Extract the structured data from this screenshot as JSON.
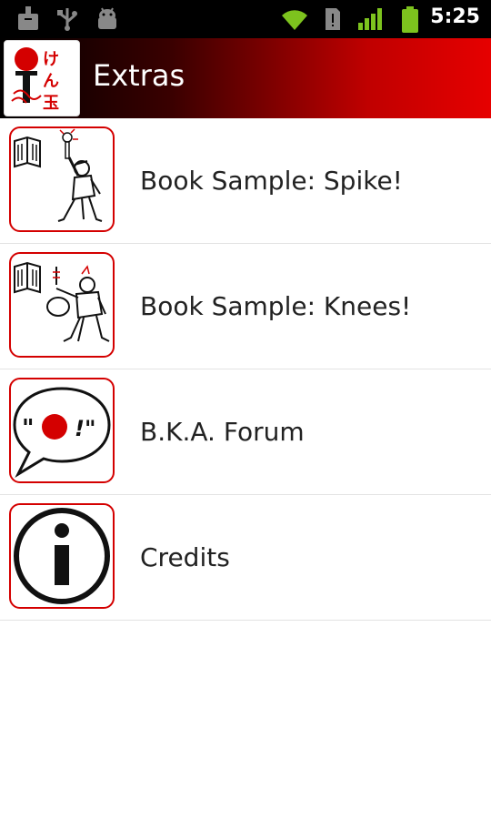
{
  "status_bar": {
    "time": "5:25",
    "icons": [
      "download-icon",
      "usb-icon",
      "android-debug-icon",
      "wifi-icon",
      "sim-icon",
      "signal-icon",
      "battery-icon"
    ]
  },
  "title_bar": {
    "title": "Extras",
    "logo_text": "けん玉"
  },
  "list": {
    "items": [
      {
        "label": "Book Sample: Spike!",
        "icon": "book-spike-icon"
      },
      {
        "label": "Book Sample: Knees!",
        "icon": "book-knees-icon"
      },
      {
        "label": "B.K.A. Forum",
        "icon": "forum-speech-bubble-icon",
        "icon_text": "\"  !\""
      },
      {
        "label": "Credits",
        "icon": "info-icon"
      }
    ]
  },
  "colors": {
    "accent": "#d40000",
    "title_gradient_start": "#000000",
    "title_gradient_end": "#e60000",
    "status_bar": "#000000",
    "wifi": "#7dc31e"
  }
}
